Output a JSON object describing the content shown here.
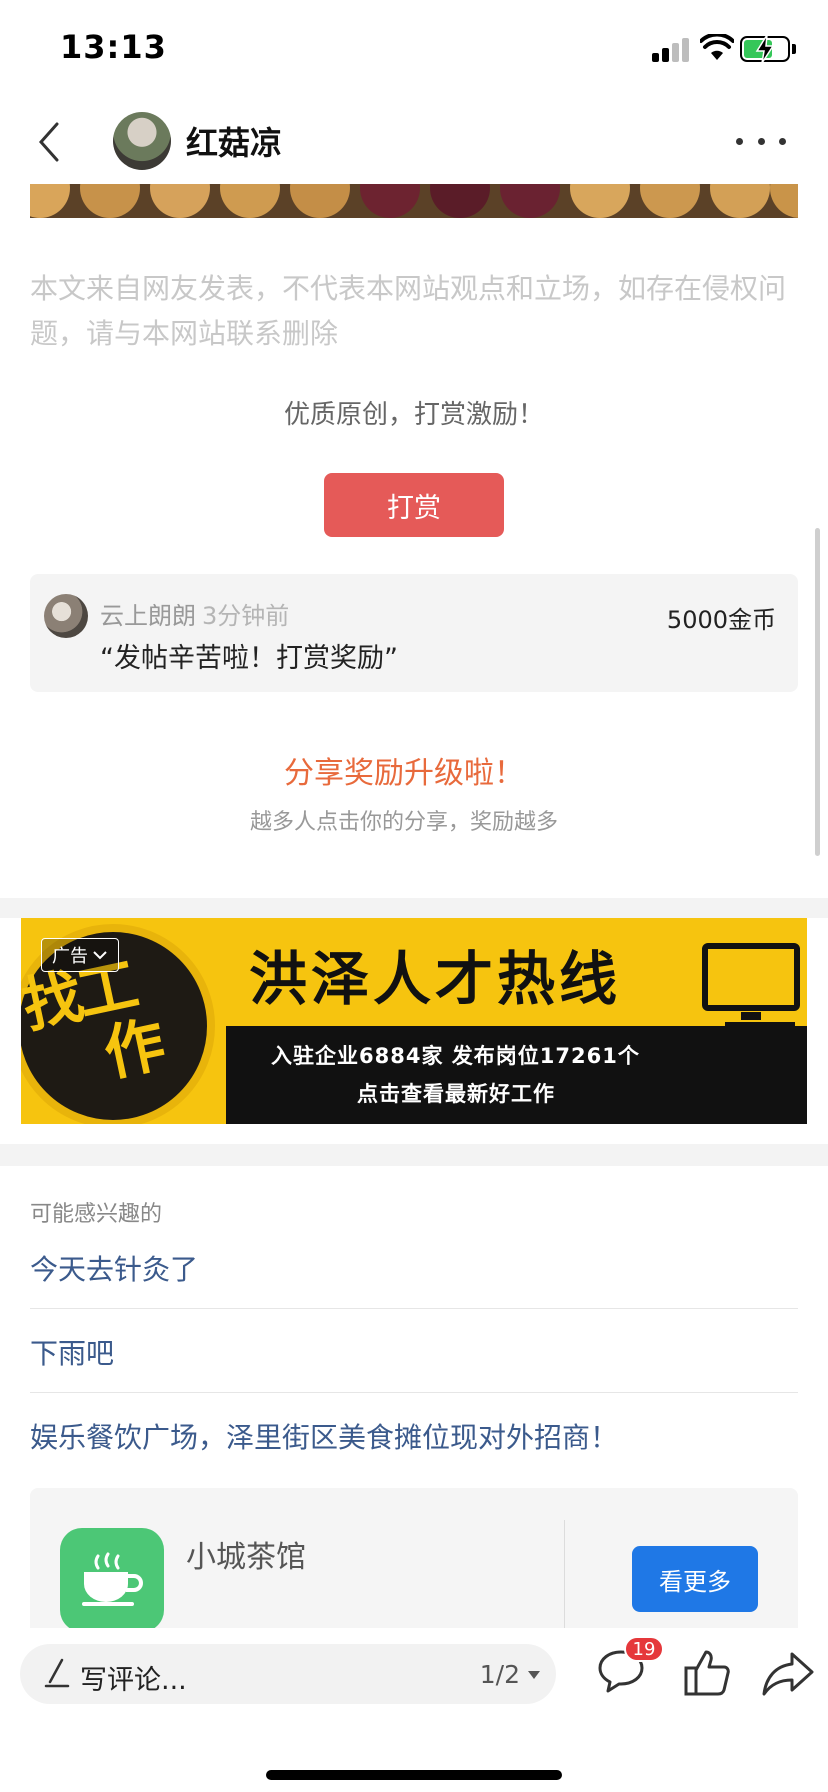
{
  "status_bar": {
    "time": "13:13"
  },
  "nav": {
    "title": "红菇凉"
  },
  "article": {
    "disclaimer": "本文来自网友发表，不代表本网站观点和立场，如存在侵权问题，请与本网站联系删除"
  },
  "reward": {
    "title": "优质原创，打赏激励！",
    "button_label": "打赏",
    "record": {
      "user": "云上朗朗",
      "time": "3分钟前",
      "message": "“发帖辛苦啦！打赏奖励”",
      "amount": "5000金币"
    }
  },
  "share": {
    "title": "分享奖励升级啦！",
    "subtitle": "越多人点击你的分享，奖励越多"
  },
  "ad": {
    "tag": "广告",
    "circle_text_line1": "找工",
    "circle_text_line2": "作",
    "headline": "洪泽人才热线",
    "line1": "入驻企业6884家  发布岗位17261个",
    "line2": "点击查看最新好工作",
    "colors": {
      "background": "#f6c40f",
      "dark": "#111111"
    }
  },
  "recommendations": {
    "label": "可能感兴趣的",
    "items": [
      {
        "title": "今天去针灸了"
      },
      {
        "title": "下雨吧"
      },
      {
        "title": "娱乐餐饮广场，泽里街区美食摊位现对外招商！"
      }
    ]
  },
  "app_card": {
    "name": "小城茶馆",
    "button_label": "看更多",
    "icon": "tea-cup-icon"
  },
  "bottom_bar": {
    "comment_placeholder": "写评论...",
    "page_indicator": "1/2",
    "comment_count": "19"
  },
  "colors": {
    "reward_button": "#e55a58",
    "share_title": "#e86a3c",
    "link": "#3b5a8c",
    "primary_button": "#1f78e6",
    "badge": "#e5383b"
  }
}
